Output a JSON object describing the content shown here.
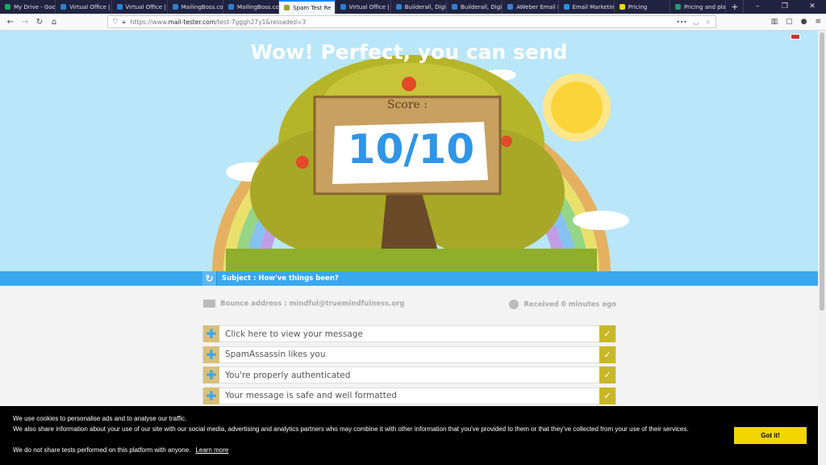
{
  "browser": {
    "tabs": [
      {
        "label": "My Drive - Goog",
        "color": "#1fa463",
        "active": false
      },
      {
        "label": "Virtual Office | B",
        "color": "#2f7fd0",
        "active": false
      },
      {
        "label": "Virtual Office | B",
        "color": "#2f7fd0",
        "active": false
      },
      {
        "label": "MailingBoss.com",
        "color": "#2f7fd0",
        "active": false
      },
      {
        "label": "MailingBoss.com",
        "color": "#2f7fd0",
        "active": false
      },
      {
        "label": "Spam Test Re",
        "color": "#a2a030",
        "active": true
      },
      {
        "label": "Virtual Office | B",
        "color": "#2f7fd0",
        "active": false
      },
      {
        "label": "Builderall, Digita",
        "color": "#2f7fd0",
        "active": false
      },
      {
        "label": "Builderall, Digita",
        "color": "#2f7fd0",
        "active": false
      },
      {
        "label": "AWeber Email M",
        "color": "#3a7ed8",
        "active": false
      },
      {
        "label": "Email Marketing",
        "color": "#2d8fe0",
        "active": false
      },
      {
        "label": "Pricing",
        "color": "#f1d600",
        "active": false
      },
      {
        "label": "Pricing and plans",
        "color": "#1d9d74",
        "active": false
      }
    ],
    "url_prefix": "https://www.",
    "url_domain": "mail-tester.com",
    "url_path": "/test-7gggh27y1&reloaded=3"
  },
  "hero": {
    "title": "Wow! Perfect, you can send",
    "score_label": "Score :",
    "score": "10/10"
  },
  "subject": "Subject : How've things been?",
  "bounce": "Bounce address : mindful@truemindfulness.org",
  "received": "Received 0 minutes ago",
  "results": [
    "Click here to view your message",
    "SpamAssassin likes you",
    "You're properly authenticated",
    "Your message is safe and well formatted"
  ],
  "cookie": {
    "line1": "We use cookies to personalise ads and to analyse our traffic.",
    "line2": "We also share information about your use of our site with our social media, advertising and analytics partners who may combine it with other information that you've provided to them or that they've collected from your use of their services.",
    "line3": "We do not share tests performed on this platform with anyone.",
    "learn_more": "Learn more",
    "button": "Got it!"
  }
}
